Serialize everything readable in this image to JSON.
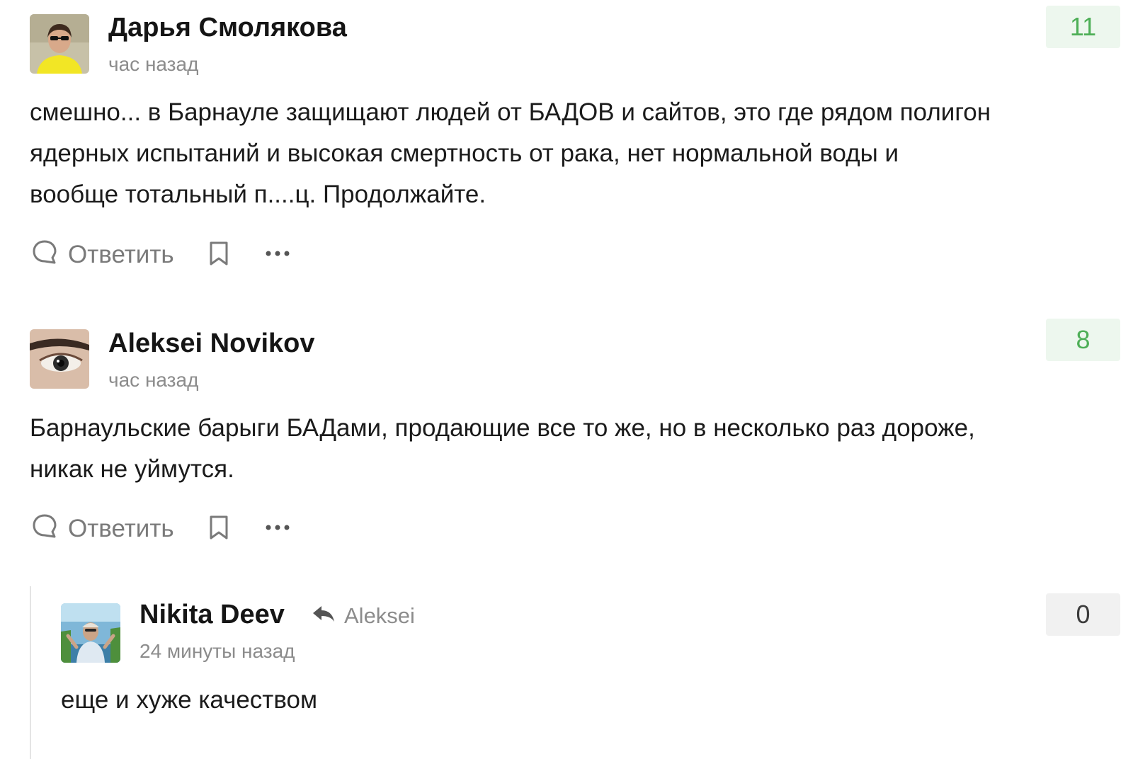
{
  "comments": [
    {
      "author": "Дарья Смолякова",
      "time": "час назад",
      "rating": "11",
      "text": "смешно... в Барнауле защищают людей от БАДОВ и сайтов, это где рядом полигон ядерных испытаний и высокая смертность от рака, нет нормальной воды и вообще тотальный п....ц. Продолжайте.",
      "actions": {
        "reply_label": "Ответить"
      }
    },
    {
      "author": "Aleksei Novikov",
      "time": "час назад",
      "rating": "8",
      "text": "Барнаульские барыги БАДами, продающие все то же, но в несколько раз дороже, никак не уймутся.",
      "actions": {
        "reply_label": "Ответить"
      }
    },
    {
      "author": "Nikita Deev",
      "reply_to": "Aleksei",
      "time": "24 минуты назад",
      "rating": "0",
      "text": "еще и хуже качеством"
    }
  ],
  "colors": {
    "rating_positive_bg": "#edf7ee",
    "rating_positive_text": "#4eaf57",
    "rating_zero_bg": "#f1f1f1",
    "muted": "#8c8c8c"
  },
  "icons": {
    "reply": "speech-bubble-icon",
    "bookmark": "bookmark-icon",
    "more": "more-dots-icon",
    "reply_to": "reply-arrow-icon"
  }
}
